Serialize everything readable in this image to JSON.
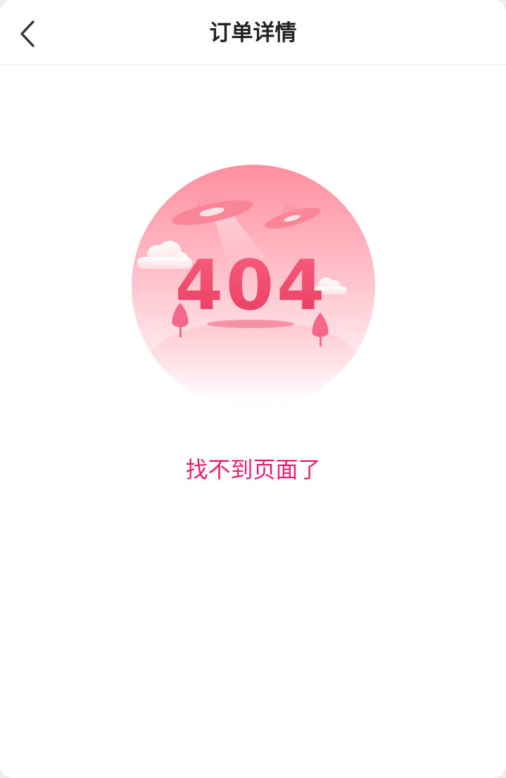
{
  "header": {
    "title": "订单详情",
    "back_icon": "chevron-left-icon"
  },
  "error": {
    "code": "404",
    "message": "找不到页面了"
  },
  "colors": {
    "accent": "#ec1f6e",
    "illustration_pink": "#f97b95",
    "illustration_dark": "#e6385e"
  }
}
